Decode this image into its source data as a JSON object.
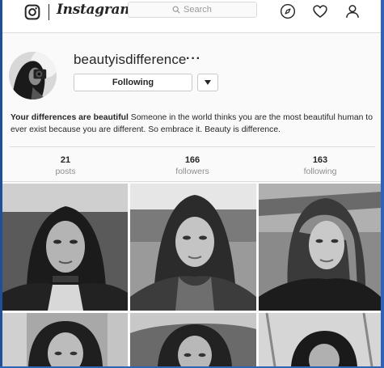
{
  "nav": {
    "wordmark": "Instagram",
    "search_placeholder": "Search",
    "icons": [
      "instagram-logo-icon",
      "search-icon",
      "compass-icon",
      "heart-icon",
      "profile-icon"
    ]
  },
  "profile": {
    "username": "beautyisdifference",
    "more_label": "···",
    "follow_label": "Following",
    "bio_name": "Your differences are beautiful",
    "bio_text": " Someone in the world thinks you are the most beautiful human to ever exist because you are different. So embrace it. Beauty is difference."
  },
  "stats": [
    {
      "count": "21",
      "label": "posts"
    },
    {
      "count": "166",
      "label": "followers"
    },
    {
      "count": "163",
      "label": "following"
    }
  ],
  "grid": {
    "rows": 2,
    "columns": 3,
    "style": "black-and-white portraits"
  },
  "colors": {
    "text": "#262626",
    "secondary": "#8e8e8e",
    "border": "#dbdbdb",
    "background": "#fafafa",
    "window_frame": "#2d63b8"
  }
}
